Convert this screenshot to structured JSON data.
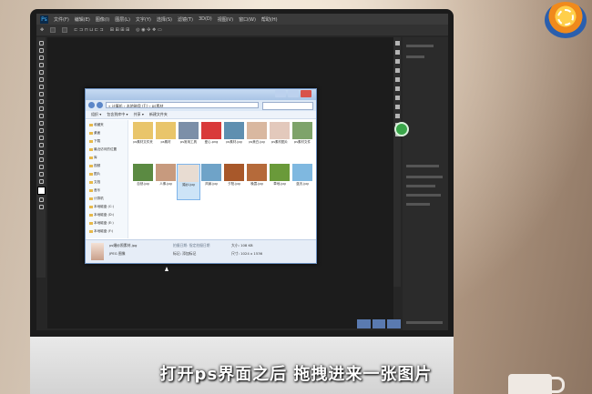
{
  "photoshop": {
    "app_icon": "Ps",
    "menu": [
      "文件(F)",
      "编辑(E)",
      "图像(I)",
      "图层(L)",
      "文字(Y)",
      "选择(S)",
      "滤镜(T)",
      "3D(D)",
      "视图(V)",
      "窗口(W)",
      "帮助(H)"
    ]
  },
  "explorer": {
    "address": "« 计算机 › 本地磁盘 (F:) › ps素材",
    "toolbar": [
      "组织 ▾",
      "包含到库中 ▾",
      "共享 ▾",
      "新建文件夹"
    ],
    "sidebar": [
      "收藏夹",
      "桌面",
      "下载",
      "最近访问的位置",
      "库",
      "视频",
      "图片",
      "文档",
      "音乐",
      "计算机",
      "本地磁盘 (C:)",
      "本地磁盘 (D:)",
      "本地磁盘 (E:)",
      "本地磁盘 (F:)"
    ],
    "files": [
      {
        "name": "ps素材文件夹",
        "color": "#e9c56a"
      },
      {
        "name": "ps素材",
        "color": "#e9c56a"
      },
      {
        "name": "ps常用工具",
        "color": "#7c8fa8"
      },
      {
        "name": "爱心.png",
        "color": "#d93a3a"
      },
      {
        "name": "ps素材.jpg",
        "color": "#5f8fb0"
      },
      {
        "name": "ps美白.jpg",
        "color": "#d9b8a0"
      },
      {
        "name": "ps素材图片",
        "color": "#e3c9bc"
      },
      {
        "name": "ps素材文件",
        "color": "#7ea36a"
      },
      {
        "name": "自然.jpg",
        "color": "#5b8a42"
      },
      {
        "name": "人像.jpg",
        "color": "#c79a7e"
      },
      {
        "name": "婚纱.jpg",
        "color": "#e8dcd2"
      },
      {
        "name": "风景.jpg",
        "color": "#6fa3c8"
      },
      {
        "name": "夕阳.jpg",
        "color": "#a8582a"
      },
      {
        "name": "晚霞.jpg",
        "color": "#b56a3a"
      },
      {
        "name": "草地.jpg",
        "color": "#6a9a3a"
      },
      {
        "name": "蓝天.jpg",
        "color": "#7fb8e0"
      }
    ],
    "status": {
      "filename": "ps婚纱照素材.jpg",
      "type": "JPEG 图像",
      "date_label": "拍摄日期: 指定拍摄日期",
      "size": "大小: 108 KB",
      "dims": "尺寸: 1024 x 1536",
      "tags": "标记: 添加标记"
    }
  },
  "subtitle": "打开ps界面之后 拖拽进来一张图片"
}
